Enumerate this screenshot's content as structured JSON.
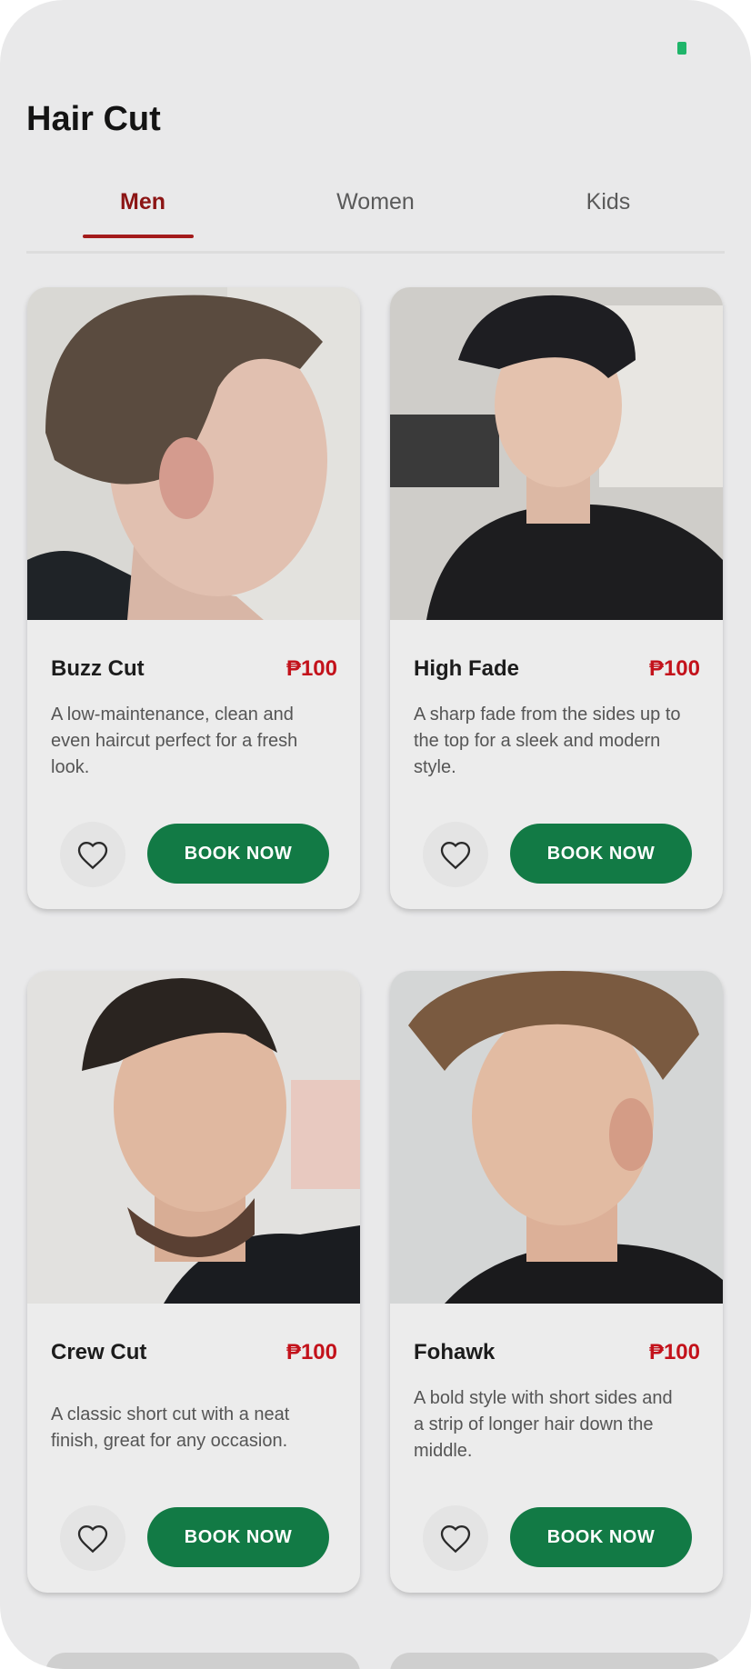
{
  "header": {
    "title": "Hair Cut"
  },
  "tabs": [
    {
      "label": "Men",
      "active": true
    },
    {
      "label": "Women",
      "active": false
    },
    {
      "label": "Kids",
      "active": false
    }
  ],
  "cards": [
    {
      "name": "Buzz Cut",
      "price": "₱100",
      "description": "A low-maintenance, clean and even haircut perfect for a fresh look.",
      "book_label": "BOOK NOW",
      "favorite": false
    },
    {
      "name": "High Fade",
      "price": "₱100",
      "description": "A sharp fade from the sides up to the top for a sleek and modern style.",
      "book_label": "BOOK NOW",
      "favorite": false
    },
    {
      "name": "Crew Cut",
      "price": "₱100",
      "description": "A classic short cut with a neat finish, great for any occasion.",
      "book_label": "BOOK NOW",
      "favorite": false
    },
    {
      "name": "Fohawk",
      "price": "₱100",
      "description": "A bold style with short sides and a strip of longer hair down the middle.",
      "book_label": "BOOK NOW",
      "favorite": false
    }
  ],
  "colors": {
    "accent": "#8c1515",
    "price": "#c3121b",
    "book_button": "#127a45",
    "background": "#e9e9ea",
    "status_indicator": "#1fb56a"
  },
  "icons": {
    "favorite": "heart-outline-icon"
  }
}
